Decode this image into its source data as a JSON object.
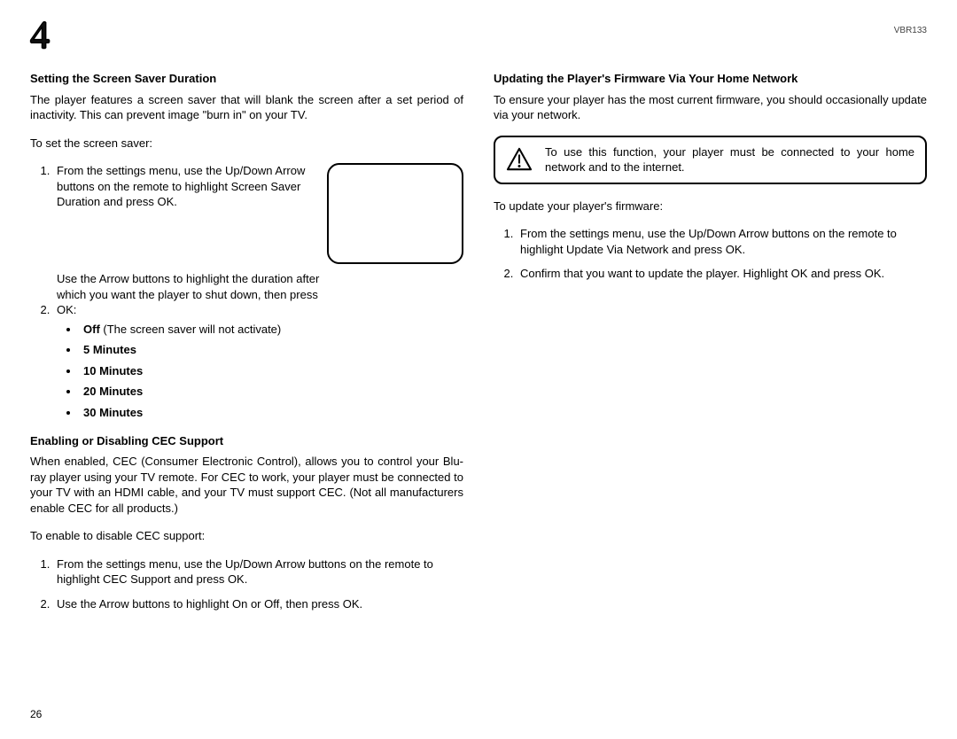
{
  "header": {
    "chapter_number": "4",
    "model": "VBR133"
  },
  "left": {
    "s1_head": "Setting the Screen Saver Duration",
    "s1_intro": "The player features a screen saver that will blank the screen after a set period of inactivity. This can prevent image \"burn in\" on your TV.",
    "s1_lead": "To set the screen saver:",
    "s1_step1": "From the settings menu, use the Up/Down Arrow buttons on the remote to highlight Screen Saver Duration and press OK.",
    "s1_step2": "Use the Arrow buttons to highlight the duration after which you want the player to shut down, then press OK:",
    "opt_off_bold": "Off",
    "opt_off_rest": " (The screen saver will not activate)",
    "opt_5": "5 Minutes",
    "opt_10": "10 Minutes",
    "opt_20": "20 Minutes",
    "opt_30": "30 Minutes",
    "s2_head": "Enabling or Disabling CEC Support",
    "s2_intro": "When enabled, CEC (Consumer Electronic Control), allows you to control your Blu-ray player using your TV remote. For CEC to work, your player must be connected to your TV with an HDMI cable, and your TV must support CEC. (Not all manufacturers enable CEC for all products.)",
    "s2_lead": "To enable to disable CEC support:",
    "s2_step1": "From the settings menu, use the Up/Down Arrow buttons on the remote to highlight CEC Support and press OK.",
    "s2_step2": "Use the Arrow buttons to highlight On or Off, then press OK."
  },
  "right": {
    "s3_head": "Updating the Player's Firmware Via Your Home Network",
    "s3_intro": "To ensure your player has the most current firmware, you should occasionally update via your network.",
    "note": "To use this function, your player must be connected to your home network and to the internet.",
    "s3_lead": "To update your player's firmware:",
    "s3_step1": "From the settings menu, use the Up/Down Arrow buttons on the remote to highlight Update Via Network and press OK.",
    "s3_step2": "Confirm that you want to update the player. Highlight OK and press OK."
  },
  "page_number": "26"
}
